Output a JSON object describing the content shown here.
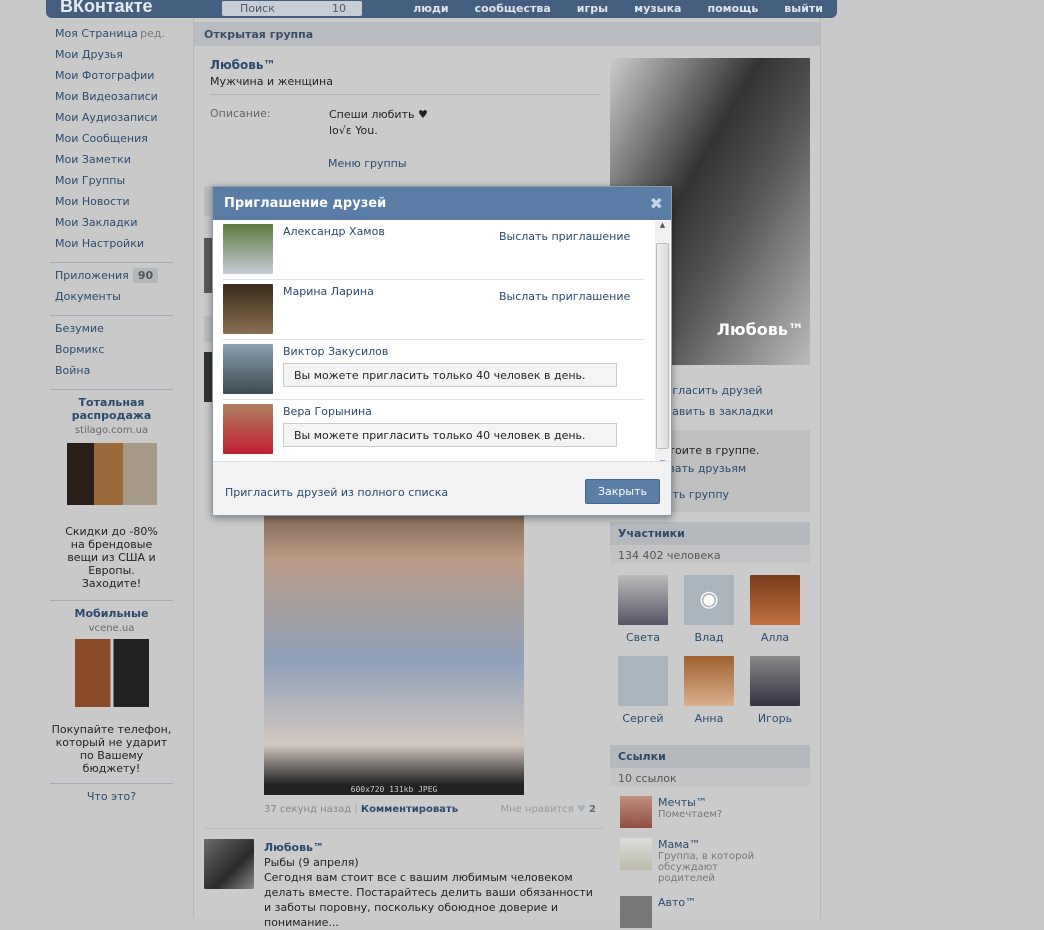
{
  "header": {
    "logo": "ВКонтакте",
    "search_placeholder": "Поиск",
    "search_count": "10",
    "nav": [
      "люди",
      "сообщества",
      "игры",
      "музыка",
      "помощь",
      "выйти"
    ]
  },
  "sidebar": {
    "edit": "ред.",
    "items": [
      "Моя Страница",
      "Мои Друзья",
      "Мои Фотографии",
      "Мои Видеозаписи",
      "Мои Аудиозаписи",
      "Мои Сообщения",
      "Мои Заметки",
      "Мои Группы",
      "Мои Новости",
      "Мои Закладки",
      "Мои Настройки"
    ],
    "apps": "Приложения",
    "apps_count": "90",
    "docs": "Документы",
    "extra": [
      "Безумие",
      "Вормикс",
      "Война"
    ],
    "ad1": {
      "title": "Тотальная распродажа",
      "domain": "stilago.com.ua",
      "text": "Скидки до -80% на брендовые вещи из США и Европы. Заходите!"
    },
    "ad2": {
      "title": "Мобильные",
      "domain": "vcene.ua",
      "text": "Покупайте телефон, который не ударит по Вашему бюджету!"
    },
    "what": "Что это?"
  },
  "group": {
    "type": "Открытая группа",
    "name": "Любовь™",
    "status": "Мужчина и женщина",
    "desc_label": "Описание:",
    "desc": [
      "Спеши любить ♥",
      "lo√ɛ You."
    ],
    "menu": "Меню группы",
    "cover_text": "Любовь™",
    "actions": [
      "Пригласить друзей",
      "Добавить в закладки"
    ],
    "member_box": [
      "Вы состоите в группе.",
      "Рассказать друзьям",
      "Покинуть группу"
    ]
  },
  "post": {
    "image_caption": "600x720 131kb JPEG",
    "time": "37 секунд назад",
    "comment": "Комментировать",
    "like": "Мне нравится",
    "likes": "2"
  },
  "post2": {
    "author": "Любовь™",
    "title": "Рыбы (9 апреля)",
    "text": "Сегодня вам стоит все с вашим любимым человеком делать вместе. Постарайтесь делить ваши обязанности и заботы поровну, поскольку обоюдное доверие и понимание..."
  },
  "members": {
    "title": "Участники",
    "count": "134 402 человека",
    "list": [
      "Света",
      "Влад",
      "Алла",
      "Сергей",
      "Анна",
      "Игорь"
    ]
  },
  "links": {
    "title": "Ссылки",
    "count": "10 ссылок",
    "items": [
      {
        "name": "Мечты™",
        "desc": "Помечтаем?"
      },
      {
        "name": "Мама™",
        "desc": "Группа, в которой обсуждают родителей"
      },
      {
        "name": "Авто™",
        "desc": ""
      }
    ]
  },
  "modal": {
    "title": "Приглашение друзей",
    "close": "✖",
    "invite": "Выслать приглашение",
    "limit": "Вы можете пригласить только 40 человек в день.",
    "friends": [
      "Александр Хамов",
      "Марина Ларина",
      "Виктор Закусилов",
      "Вера Горынина"
    ],
    "full_list": "Пригласить друзей из полного списка",
    "close_btn": "Закрыть"
  }
}
